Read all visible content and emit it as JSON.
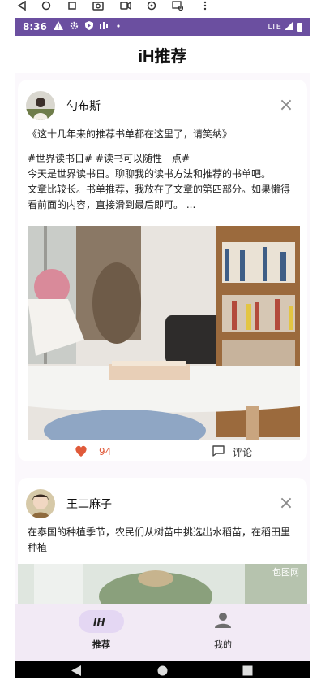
{
  "status_bar": {
    "time": "8:36",
    "network": "LTE"
  },
  "app_bar": {
    "title": "iH推荐"
  },
  "posts": [
    {
      "author": "勺布斯",
      "title": "《这十几年来的推荐书单都在这里了，请笑纳》",
      "body": "#世界读书日# #读书可以随性一点#\n今天是世界读书日。聊聊我的读书方法和推荐的书单吧。\n文章比较长。书单推荐，我放在了文章的第四部分。如果懒得看前面的内容，直接滑到最后即可。 ...",
      "likes": "94",
      "comment_label": "评论"
    },
    {
      "author": "王二麻子",
      "title": "在泰国的种植季节，农民们从树苗中挑选出水稻苗，在稻田里种植",
      "watermark": "包图网"
    }
  ],
  "bottom_nav": {
    "items": [
      {
        "label": "推荐",
        "selected": true
      },
      {
        "label": "我的",
        "selected": false
      }
    ]
  },
  "colors": {
    "status_bar": "#6b4fa0",
    "like": "#e05a3a",
    "nav_bg": "#f2eaf5",
    "nav_pill": "#e4d7f3"
  }
}
